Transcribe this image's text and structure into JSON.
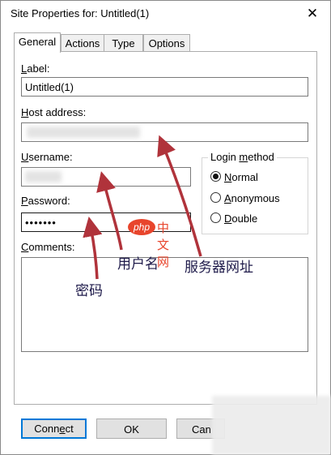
{
  "window": {
    "title": "Site Properties for: Untitled(1)",
    "close_glyph": "✕"
  },
  "tabs": [
    {
      "label": "General",
      "active": true
    },
    {
      "label": "Actions",
      "active": false
    },
    {
      "label": "Type",
      "active": false
    },
    {
      "label": "Options",
      "active": false
    }
  ],
  "fields": {
    "label": {
      "label_key": "L",
      "label_rest": "abel:",
      "value": "Untitled(1)"
    },
    "host": {
      "label_key": "H",
      "label_rest": "ost address:"
    },
    "username": {
      "label_key": "U",
      "label_rest": "sername:"
    },
    "password": {
      "label_key": "P",
      "label_rest": "assword:",
      "value": "•••••••"
    },
    "comments": {
      "label_key": "C",
      "label_rest": "omments:"
    }
  },
  "login_method": {
    "title_pre": "Login ",
    "title_key": "m",
    "title_post": "ethod",
    "options": [
      {
        "key": "N",
        "rest": "ormal",
        "checked": true
      },
      {
        "key": "A",
        "rest": "nonymous",
        "checked": false
      },
      {
        "key": "D",
        "rest": "ouble",
        "checked": false
      }
    ]
  },
  "buttons": {
    "connect_pre": "Conn",
    "connect_key": "e",
    "connect_post": "ct",
    "ok": "OK",
    "cancel_partial": "Can"
  },
  "annotations": {
    "host": "服务器网址",
    "username": "用户名",
    "password": "密码",
    "color": "#b0333b"
  },
  "watermark": {
    "php": "php",
    "site": "中文网"
  }
}
